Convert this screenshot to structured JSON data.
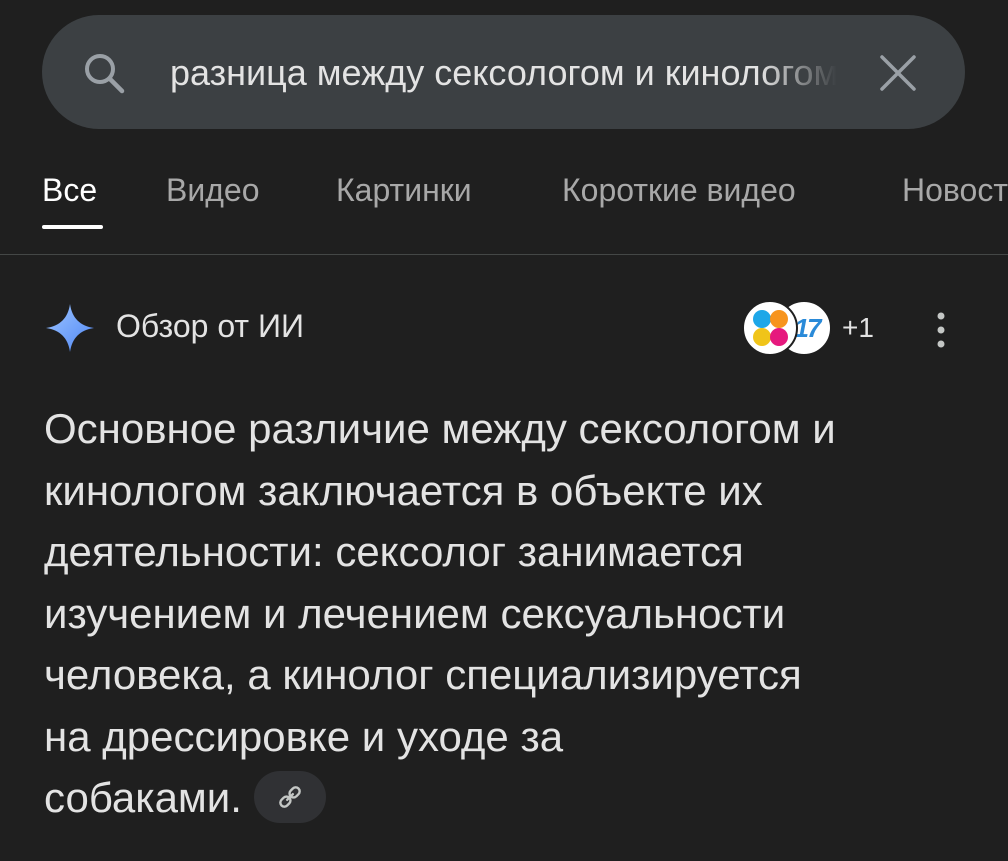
{
  "search": {
    "query": "разница между сексологом и кинологом",
    "search_icon": "search-icon",
    "clear_icon": "close-icon"
  },
  "tabs": [
    {
      "label": "Все",
      "active": true
    },
    {
      "label": "Видео",
      "active": false
    },
    {
      "label": "Картинки",
      "active": false
    },
    {
      "label": "Короткие видео",
      "active": false
    },
    {
      "label": "Новости",
      "active": false
    }
  ],
  "ai_overview": {
    "icon": "sparkle-icon",
    "title": "Обзор от ИИ",
    "sources": {
      "favicon_b_text": "17",
      "more_count": "+1"
    },
    "more_icon": "more-vert-icon",
    "answer_lines": [
      "Основное различие между сексологом и",
      "кинологом заключается в объекте их",
      "деятельности: сексолог занимается",
      "изучением и лечением сексуальности",
      "человека, а кинолог специализируется",
      "на дрессировке и уходе за",
      "собаками."
    ],
    "link_icon": "link-icon"
  },
  "colors": {
    "background": "#1f1f1f",
    "search_bar": "#3c4043",
    "text_primary": "#e3e3e3",
    "text_secondary": "#a8a8a8",
    "sparkle": "#6ea8fe",
    "favicon_blue": "#2a8ad8"
  }
}
